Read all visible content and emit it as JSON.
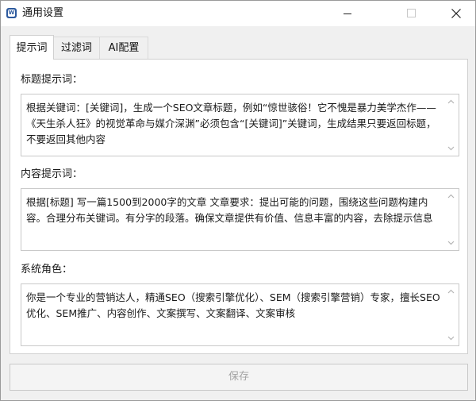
{
  "window": {
    "title": "通用设置",
    "icon": "app-logo-icon",
    "icon_text": "W"
  },
  "tabs": [
    {
      "label": "提示词",
      "active": true
    },
    {
      "label": "过滤词",
      "active": false
    },
    {
      "label": "AI配置",
      "active": false
    }
  ],
  "fields": {
    "title_prompt": {
      "label": "标题提示词：",
      "value": "根据关键词：[关键词]，生成一个SEO文章标题，例如“惊世骇俗！它不愧是暴力美学杰作——《天生杀人狂》的视觉革命与媒介深渊”必须包含“[关键词]”关键词，生成结果只要返回标题，不要返回其他内容"
    },
    "content_prompt": {
      "label": "内容提示词：",
      "value": "根据[标题] 写一篇1500到2000字的文章 文章要求：提出可能的问题，围绕这些问题构建内容。合理分布关键词。有分字的段落。确保文章提供有价值、信息丰富的内容，去除提示信息"
    },
    "system_role": {
      "label": "系统角色：",
      "value": "你是一个专业的营销达人，精通SEO（搜索引擎优化）、SEM（搜索引擎营销）专家，擅长SEO优化、SEM推广、内容创作、文案撰写、文案翻译、文案审核"
    }
  },
  "save_label": "保存",
  "colors": {
    "disabled_text": "#a3a3a3",
    "border": "#c9c9c9",
    "window_bg": "#f0f0f0"
  }
}
